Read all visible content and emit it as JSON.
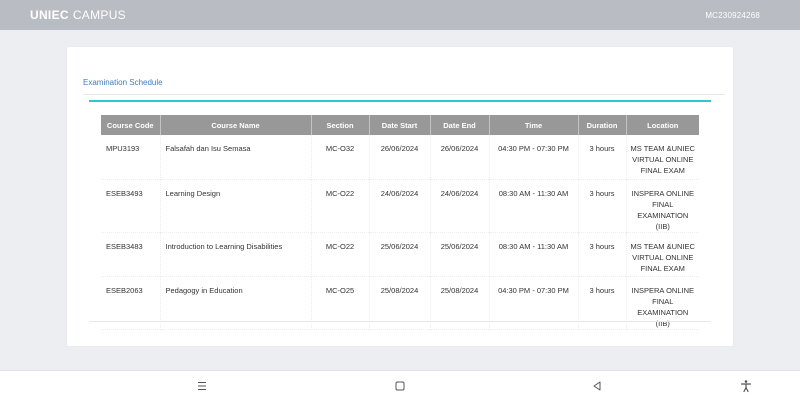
{
  "app": {
    "brand_bold": "UNIEC",
    "brand_rest": "CAMPUS",
    "user_id": "MC230924268"
  },
  "page": {
    "tab_title": "Examination Schedule"
  },
  "table": {
    "headers": [
      "Course Code",
      "Course Name",
      "Section",
      "Date Start",
      "Date End",
      "Time",
      "Duration",
      "Location"
    ],
    "rows": [
      [
        "MPU3193",
        "Falsafah dan Isu Semasa",
        "MC-O32",
        "26/06/2024",
        "26/06/2024",
        "04:30 PM - 07:30 PM",
        "3 hours",
        "MS TEAM &UNIEC VIRTUAL ONLINE FINAL EXAM"
      ],
      [
        "ESEB3493",
        "Learning Design",
        "MC-O22",
        "24/06/2024",
        "24/06/2024",
        "08:30 AM - 11:30 AM",
        "3 hours",
        "INSPERA ONLINE FINAL EXAMINATION (IIB)"
      ],
      [
        "ESEB3483",
        "Introduction to Learning Disabilities",
        "MC-O22",
        "25/06/2024",
        "25/06/2024",
        "08:30 AM - 11:30 AM",
        "3 hours",
        "MS TEAM &UNIEC VIRTUAL ONLINE FINAL EXAM"
      ],
      [
        "ESEB2063",
        "Pedagogy in Education",
        "MC-O25",
        "25/08/2024",
        "25/08/2024",
        "04:30 PM - 07:30 PM",
        "3 hours",
        "INSPERA ONLINE FINAL EXAMINATION (IIB)"
      ]
    ]
  },
  "navbar": {
    "icons": [
      "menu-icon",
      "home-square-icon",
      "back-triangle-icon",
      "accessibility-icon"
    ]
  },
  "colors": {
    "topbar": "#b9bcc2",
    "accent": "#2ec6d3",
    "header_bg": "#989898",
    "tab_text": "#3a7fc2"
  }
}
